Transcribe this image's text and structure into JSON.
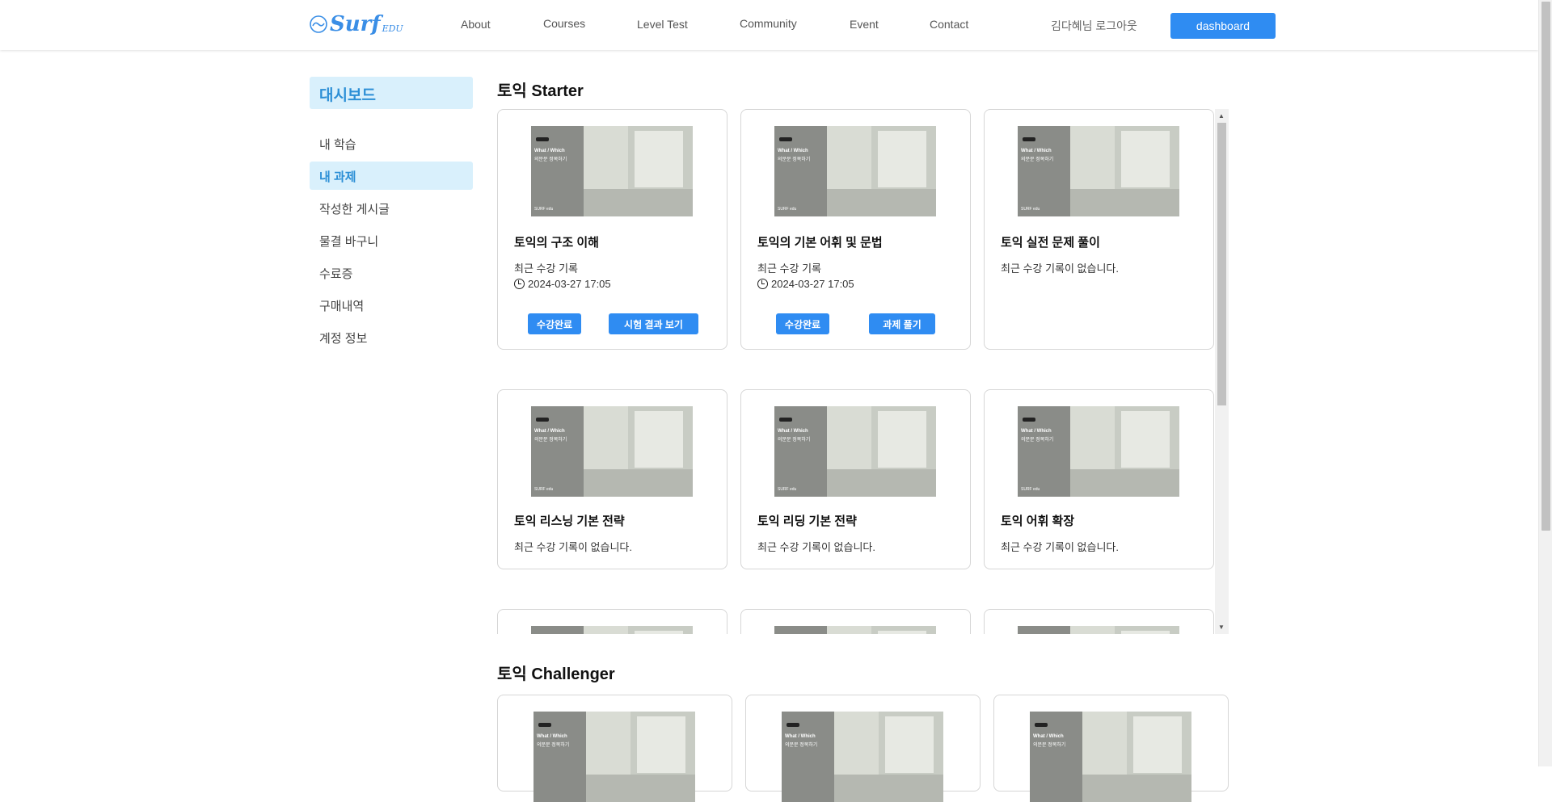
{
  "header": {
    "logo_text": "Surf",
    "logo_sub": "EDU",
    "nav": [
      "About",
      "Courses",
      "Level Test",
      "Community",
      "Event",
      "Contact"
    ],
    "logout": "김다혜님 로그아웃",
    "dashboard_button": "dashboard"
  },
  "sidebar": {
    "title": "대시보드",
    "items": [
      "내 학습",
      "내 과제",
      "작성한 게시글",
      "물결 바구니",
      "수료증",
      "구매내역",
      "계정 정보"
    ],
    "active": "내 과제"
  },
  "thumbnail": {
    "line1": "What / Which",
    "line2": "의문문 정복하기",
    "footer": "SURF edu"
  },
  "sections": {
    "starter_title": "토익 Starter",
    "challenger_title": "토익 Challenger"
  },
  "starter_cards": [
    {
      "title": "토익의 구조 이해",
      "subtitle": "최근 수강 기록",
      "date": "2024-03-27 17:05",
      "btn1": "수강완료",
      "btn2": "시험 결과 보기"
    },
    {
      "title": "토익의 기본 어휘 및 문법",
      "subtitle": "최근 수강 기록",
      "date": "2024-03-27 17:05",
      "btn1": "수강완료",
      "btn2": "과제 풀기"
    },
    {
      "title": "토익 실전 문제 풀이",
      "subtitle": "최근 수강 기록이 없습니다."
    },
    {
      "title": "토익 리스닝 기본 전략",
      "subtitle": "최근 수강 기록이 없습니다."
    },
    {
      "title": "토익 리딩 기본 전략",
      "subtitle": "최근 수강 기록이 없습니다."
    },
    {
      "title": "토익 어휘 확장",
      "subtitle": "최근 수강 기록이 없습니다."
    }
  ],
  "colors": {
    "accent": "#2f8cf2",
    "sidebar_active_bg": "#d9f0fc",
    "sidebar_active_text": "#2c8fd6"
  }
}
